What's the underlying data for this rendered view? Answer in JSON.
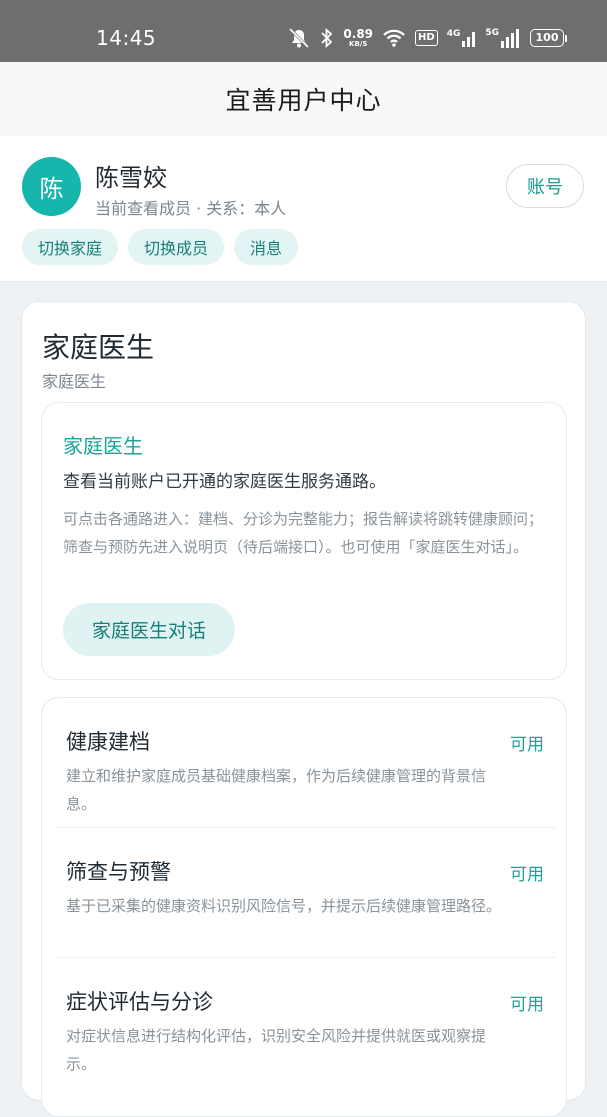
{
  "status_bar": {
    "time": "14:45",
    "net_speed_value": "0.89",
    "net_speed_unit": "KB/S",
    "hd_badge": "HD",
    "signal_4g": "4G",
    "signal_5g": "5G",
    "battery": "100"
  },
  "header": {
    "title": "宜善用户中心"
  },
  "profile": {
    "avatar_char": "陈",
    "name": "陈雪姣",
    "subtitle": "当前查看成员 · 关系：本人",
    "account_button": "账号",
    "chips": [
      "切换家庭",
      "切换成员",
      "消息"
    ]
  },
  "section": {
    "title": "家庭医生",
    "subtitle": "家庭医生",
    "intro": {
      "title": "家庭医生",
      "description": "查看当前账户已开通的家庭医生服务通路。",
      "note": "可点击各通路进入：建档、分诊为完整能力；报告解读将跳转健康顾问；筛查与预防先进入说明页（待后端接口）。也可使用「家庭医生对话」。",
      "chat_button": "家庭医生对话"
    },
    "services": [
      {
        "name": "健康建档",
        "status": "可用",
        "description": "建立和维护家庭成员基础健康档案，作为后续健康管理的背景信息。"
      },
      {
        "name": "筛查与预警",
        "status": "可用",
        "description": "基于已采集的健康资料识别风险信号，并提示后续健康管理路径。"
      },
      {
        "name": "症状评估与分诊",
        "status": "可用",
        "description": "对症状信息进行结构化评估，识别安全风险并提供就医或观察提示。"
      }
    ]
  },
  "colors": {
    "accent": "#1ca499",
    "avatar_bg": "#16b6ad",
    "chip_bg": "#e2f4f3",
    "status_bar_bg": "#6e6e6e"
  }
}
